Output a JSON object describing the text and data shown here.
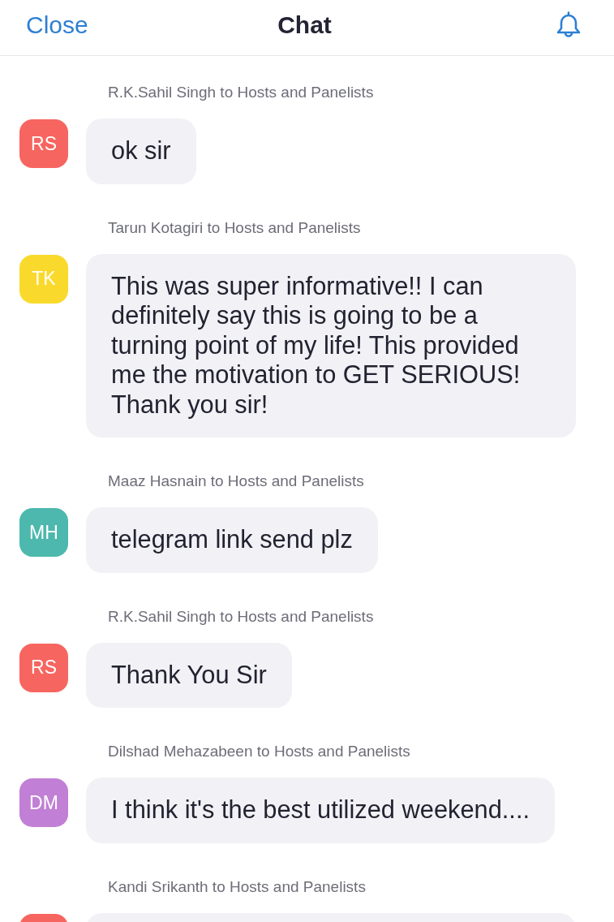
{
  "header": {
    "close": "Close",
    "title": "Chat"
  },
  "messages": [
    {
      "sender": "R.K.Sahil Singh to Hosts and Panelists",
      "avatar": {
        "initials": "RS",
        "color": "#f76560"
      },
      "text": "ok sir"
    },
    {
      "sender": "Tarun Kotagiri to Hosts and Panelists",
      "avatar": {
        "initials": "TK",
        "color": "#f9da2c"
      },
      "text": "This was super informative!! I can definitely say this is going to be a turning point of my life! This provided me the motivation to GET SERIOUS! Thank you sir!"
    },
    {
      "sender": "Maaz Hasnain to Hosts and Panelists",
      "avatar": {
        "initials": "MH",
        "color": "#4db8ad"
      },
      "text": "telegram link send plz"
    },
    {
      "sender": "R.K.Sahil Singh to Hosts and Panelists",
      "avatar": {
        "initials": "RS",
        "color": "#f76560"
      },
      "text": "Thank You Sir"
    },
    {
      "sender": "Dilshad Mehazabeen to Hosts and Panelists",
      "avatar": {
        "initials": "DM",
        "color": "#c17fd5"
      },
      "text": "I think it's the best utilized weekend...."
    },
    {
      "sender": "Kandi Srikanth to Hosts and Panelists",
      "avatar": {
        "color": "#f76560"
      }
    }
  ]
}
